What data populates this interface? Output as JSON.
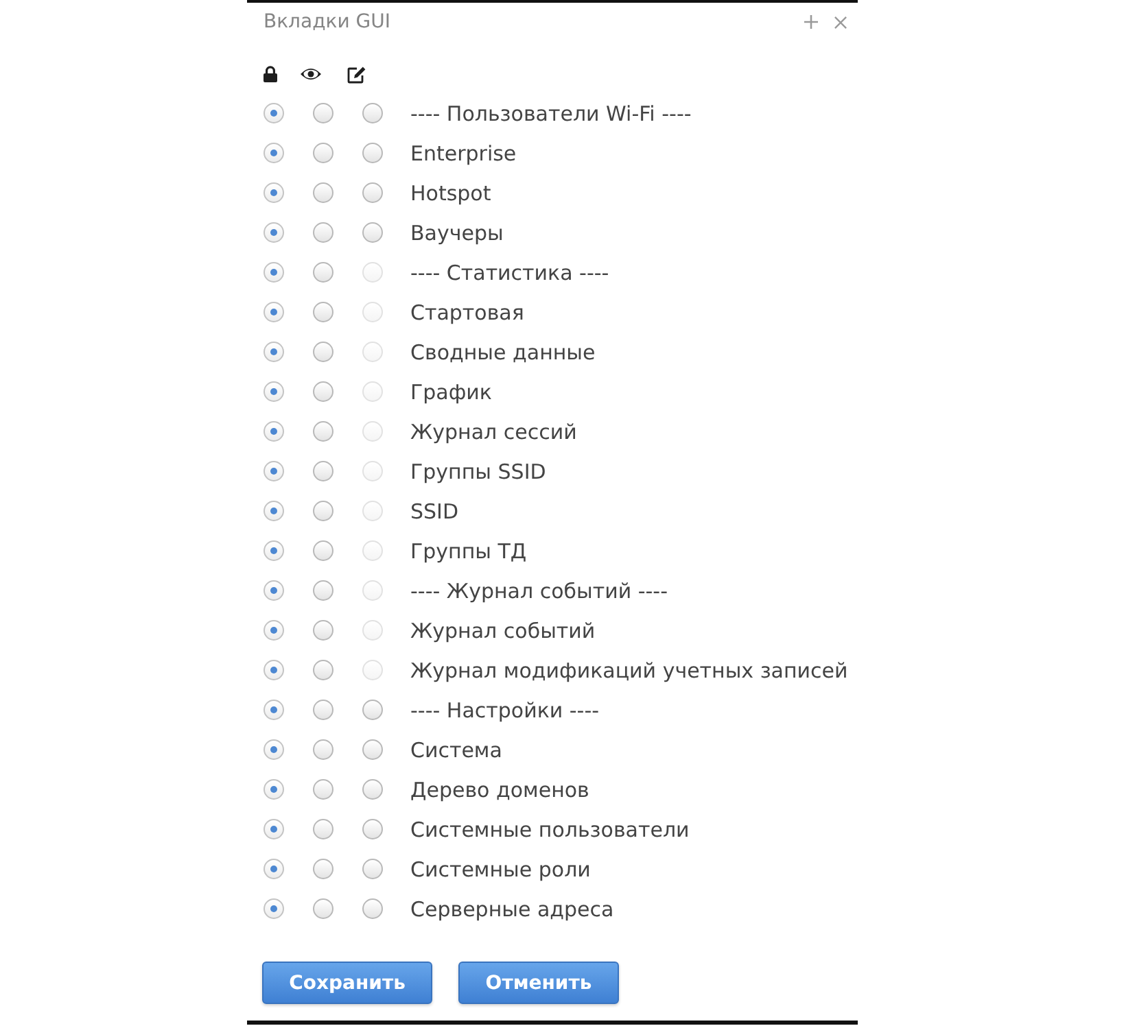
{
  "dialog": {
    "title": "Вкладки GUI"
  },
  "rows": [
    {
      "label": "---- Пользователи Wi-Fi ----",
      "options": [
        {
          "selected": true,
          "disabled": false
        },
        {
          "selected": false,
          "disabled": false
        },
        {
          "selected": false,
          "disabled": false
        }
      ]
    },
    {
      "label": "Enterprise",
      "options": [
        {
          "selected": true,
          "disabled": false
        },
        {
          "selected": false,
          "disabled": false
        },
        {
          "selected": false,
          "disabled": false
        }
      ]
    },
    {
      "label": "Hotspot",
      "options": [
        {
          "selected": true,
          "disabled": false
        },
        {
          "selected": false,
          "disabled": false
        },
        {
          "selected": false,
          "disabled": false
        }
      ]
    },
    {
      "label": "Ваучеры",
      "options": [
        {
          "selected": true,
          "disabled": false
        },
        {
          "selected": false,
          "disabled": false
        },
        {
          "selected": false,
          "disabled": false
        }
      ]
    },
    {
      "label": "---- Статистика ----",
      "options": [
        {
          "selected": true,
          "disabled": false
        },
        {
          "selected": false,
          "disabled": false
        },
        {
          "selected": false,
          "disabled": true
        }
      ]
    },
    {
      "label": "Стартовая",
      "options": [
        {
          "selected": true,
          "disabled": false
        },
        {
          "selected": false,
          "disabled": false
        },
        {
          "selected": false,
          "disabled": true
        }
      ]
    },
    {
      "label": "Сводные данные",
      "options": [
        {
          "selected": true,
          "disabled": false
        },
        {
          "selected": false,
          "disabled": false
        },
        {
          "selected": false,
          "disabled": true
        }
      ]
    },
    {
      "label": "График",
      "options": [
        {
          "selected": true,
          "disabled": false
        },
        {
          "selected": false,
          "disabled": false
        },
        {
          "selected": false,
          "disabled": true
        }
      ]
    },
    {
      "label": "Журнал сессий",
      "options": [
        {
          "selected": true,
          "disabled": false
        },
        {
          "selected": false,
          "disabled": false
        },
        {
          "selected": false,
          "disabled": true
        }
      ]
    },
    {
      "label": "Группы SSID",
      "options": [
        {
          "selected": true,
          "disabled": false
        },
        {
          "selected": false,
          "disabled": false
        },
        {
          "selected": false,
          "disabled": true
        }
      ]
    },
    {
      "label": "SSID",
      "options": [
        {
          "selected": true,
          "disabled": false
        },
        {
          "selected": false,
          "disabled": false
        },
        {
          "selected": false,
          "disabled": true
        }
      ]
    },
    {
      "label": "Группы ТД",
      "options": [
        {
          "selected": true,
          "disabled": false
        },
        {
          "selected": false,
          "disabled": false
        },
        {
          "selected": false,
          "disabled": true
        }
      ]
    },
    {
      "label": "---- Журнал событий ----",
      "options": [
        {
          "selected": true,
          "disabled": false
        },
        {
          "selected": false,
          "disabled": false
        },
        {
          "selected": false,
          "disabled": true
        }
      ]
    },
    {
      "label": "Журнал событий",
      "options": [
        {
          "selected": true,
          "disabled": false
        },
        {
          "selected": false,
          "disabled": false
        },
        {
          "selected": false,
          "disabled": true
        }
      ]
    },
    {
      "label": "Журнал модификаций учетных записей",
      "options": [
        {
          "selected": true,
          "disabled": false
        },
        {
          "selected": false,
          "disabled": false
        },
        {
          "selected": false,
          "disabled": true
        }
      ]
    },
    {
      "label": "---- Настройки ----",
      "options": [
        {
          "selected": true,
          "disabled": false
        },
        {
          "selected": false,
          "disabled": false
        },
        {
          "selected": false,
          "disabled": false
        }
      ]
    },
    {
      "label": "Система",
      "options": [
        {
          "selected": true,
          "disabled": false
        },
        {
          "selected": false,
          "disabled": false
        },
        {
          "selected": false,
          "disabled": false
        }
      ]
    },
    {
      "label": "Дерево доменов",
      "options": [
        {
          "selected": true,
          "disabled": false
        },
        {
          "selected": false,
          "disabled": false
        },
        {
          "selected": false,
          "disabled": false
        }
      ]
    },
    {
      "label": "Системные пользователи",
      "options": [
        {
          "selected": true,
          "disabled": false
        },
        {
          "selected": false,
          "disabled": false
        },
        {
          "selected": false,
          "disabled": false
        }
      ]
    },
    {
      "label": "Системные роли",
      "options": [
        {
          "selected": true,
          "disabled": false
        },
        {
          "selected": false,
          "disabled": false
        },
        {
          "selected": false,
          "disabled": false
        }
      ]
    },
    {
      "label": "Серверные адреса",
      "options": [
        {
          "selected": true,
          "disabled": false
        },
        {
          "selected": false,
          "disabled": false
        },
        {
          "selected": false,
          "disabled": false
        }
      ]
    }
  ],
  "buttons": [
    "Сохранить",
    "Отменить"
  ]
}
